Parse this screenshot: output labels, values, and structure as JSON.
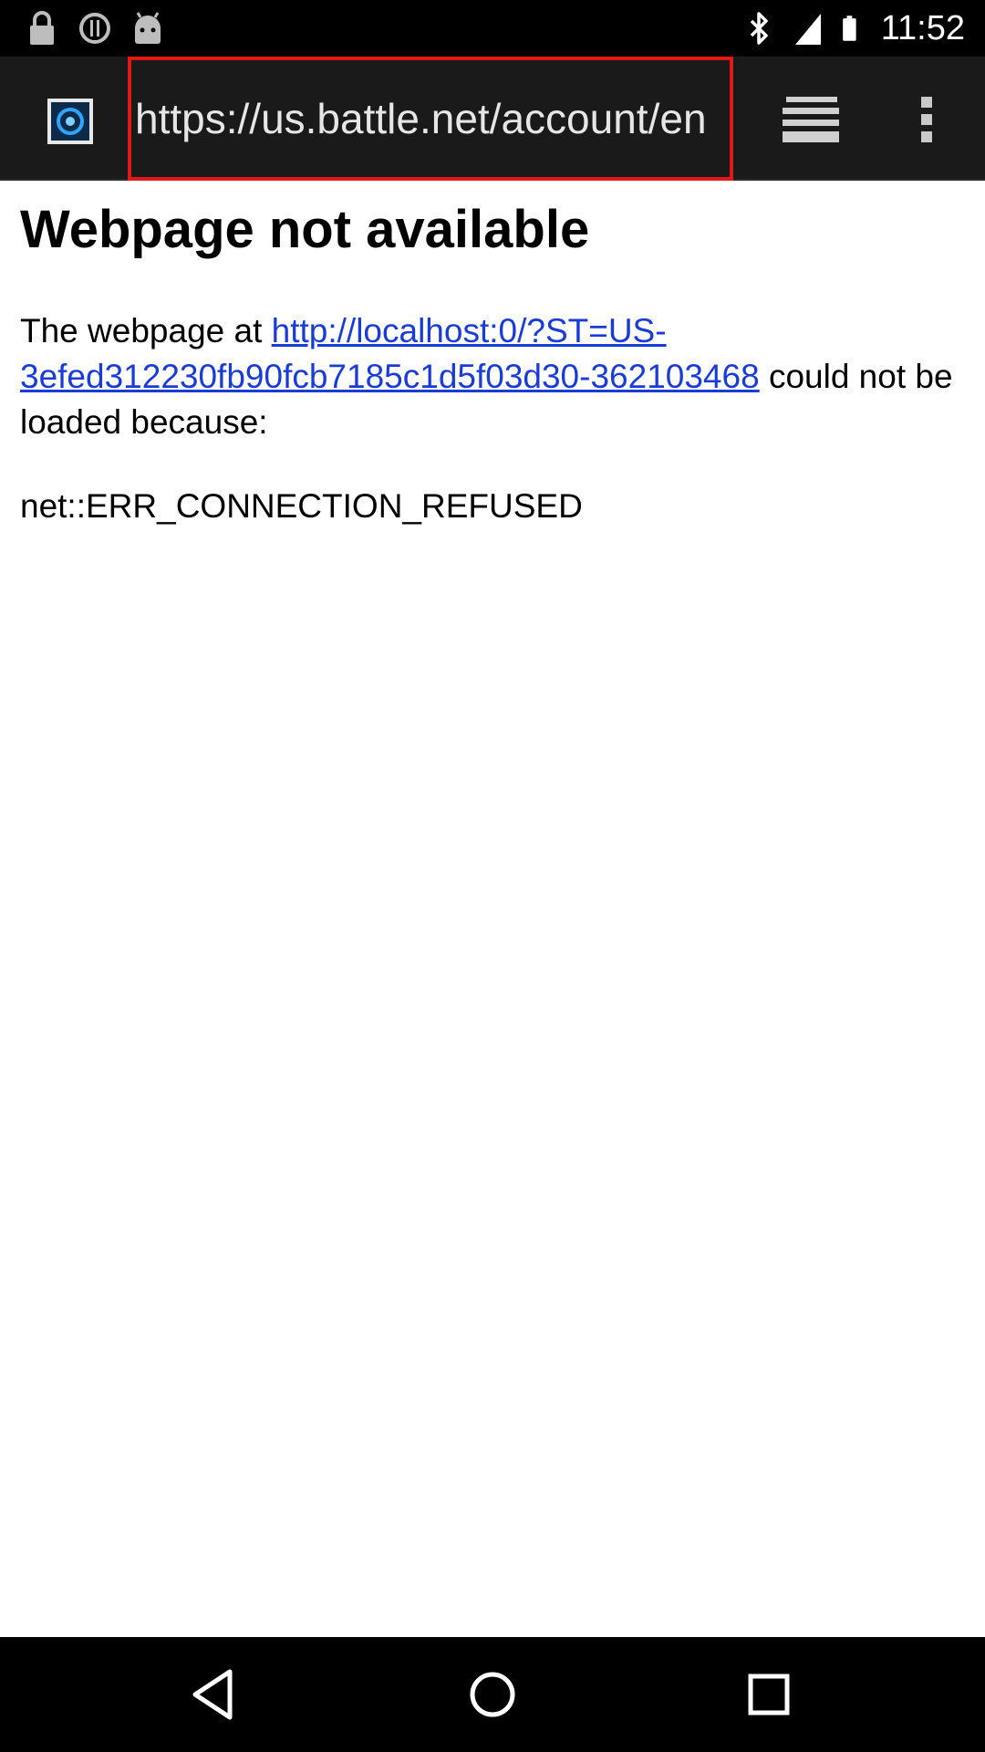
{
  "status_bar": {
    "time": "11:52",
    "icons": [
      "lock-icon",
      "sync-icon",
      "android-icon",
      "bluetooth-icon",
      "signal-icon",
      "battery-icon"
    ]
  },
  "browser": {
    "url": "https://us.battle.net/account/en",
    "favicon": "battle-net-favicon-icon",
    "tabs_icon": "tabs-stack-icon",
    "menu_icon": "overflow-menu-icon"
  },
  "page": {
    "title": "Webpage not available",
    "message_prefix": "The webpage at ",
    "link_url": "http://localhost:0/?ST=US-3efed312230fb90fcb7185c1d5f03d30-362103468",
    "message_suffix": " could not be loaded because:",
    "error_code": "net::ERR_CONNECTION_REFUSED"
  },
  "nav_bar": {
    "icons": [
      "back-icon",
      "home-icon",
      "recents-icon"
    ]
  },
  "colors": {
    "link": "#1a3cd6",
    "url_highlight": "#e01818",
    "toolbar_bg": "#1a1a1a"
  }
}
